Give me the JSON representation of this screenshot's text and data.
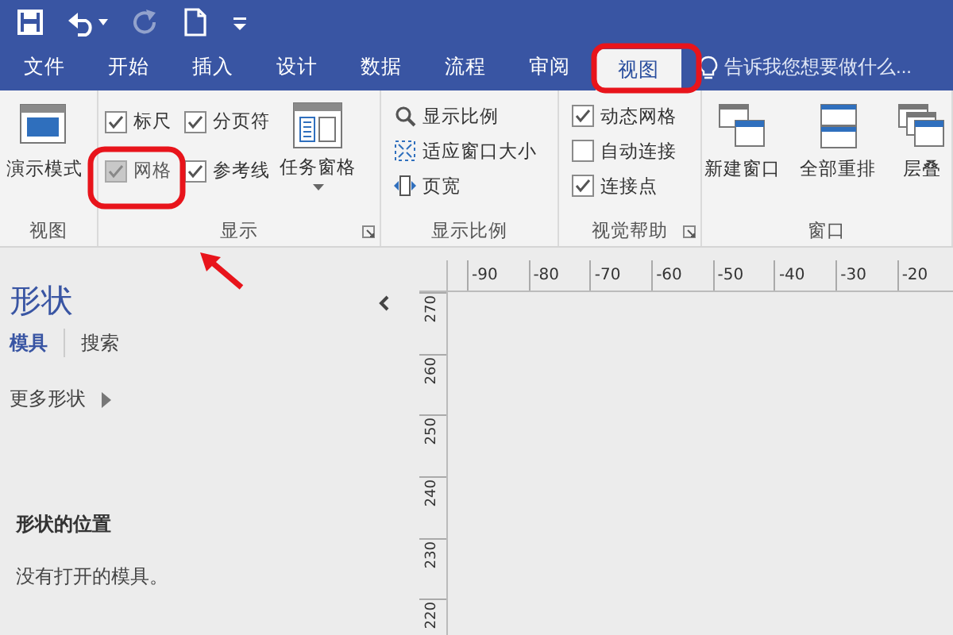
{
  "quick_access": [
    {
      "kind": "save",
      "disabled": false
    },
    {
      "kind": "undo",
      "disabled": false
    },
    {
      "kind": "redo",
      "disabled": true
    },
    {
      "kind": "new",
      "disabled": false
    },
    {
      "kind": "customize",
      "disabled": false
    }
  ],
  "tabs": [
    {
      "label": "文件",
      "selected": false
    },
    {
      "label": "开始",
      "selected": false
    },
    {
      "label": "插入",
      "selected": false
    },
    {
      "label": "设计",
      "selected": false
    },
    {
      "label": "数据",
      "selected": false
    },
    {
      "label": "流程",
      "selected": false
    },
    {
      "label": "审阅",
      "selected": false
    },
    {
      "label": "视图",
      "selected": true
    }
  ],
  "tell_me": {
    "placeholder": "告诉我您想要做什么..."
  },
  "ribbon_groups": [
    {
      "label": "视图",
      "launcher": false,
      "items": [
        {
          "kind": "large",
          "label": "演示模式"
        }
      ]
    },
    {
      "label": "显示",
      "launcher": true,
      "items": [
        {
          "kind": "check",
          "label": "标尺",
          "checked": true,
          "disabled": false
        },
        {
          "kind": "check",
          "label": "分页符",
          "checked": true,
          "disabled": false
        },
        {
          "kind": "check",
          "label": "网格",
          "checked": true,
          "disabled": true
        },
        {
          "kind": "check",
          "label": "参考线",
          "checked": true,
          "disabled": false
        },
        {
          "kind": "large",
          "label": "任务窗格",
          "dropdown": true
        }
      ]
    },
    {
      "label": "显示比例",
      "launcher": false,
      "items": [
        {
          "kind": "small",
          "label": "显示比例"
        },
        {
          "kind": "small",
          "label": "适应窗口大小"
        },
        {
          "kind": "small",
          "label": "页宽"
        }
      ]
    },
    {
      "label": "视觉帮助",
      "launcher": true,
      "items": [
        {
          "kind": "check",
          "label": "动态网格",
          "checked": true,
          "disabled": false
        },
        {
          "kind": "check",
          "label": "自动连接",
          "checked": false,
          "disabled": false
        },
        {
          "kind": "check",
          "label": "连接点",
          "checked": true,
          "disabled": false
        }
      ]
    },
    {
      "label": "窗口",
      "launcher": false,
      "items": [
        {
          "kind": "large",
          "label": "新建窗口"
        },
        {
          "kind": "large",
          "label": "全部重排"
        },
        {
          "kind": "large",
          "label": "层叠"
        }
      ]
    }
  ],
  "shapes_panel": {
    "title": "形状",
    "tabs": [
      {
        "label": "模具",
        "selected": true
      },
      {
        "label": "搜索",
        "selected": false
      }
    ],
    "more_shapes": "更多形状",
    "section_title": "形状的位置",
    "message": "没有打开的模具。"
  },
  "ruler": {
    "horizontal": [
      "-90",
      "-80",
      "-70",
      "-60",
      "-50",
      "-40",
      "-30",
      "-20"
    ],
    "vertical": [
      "270",
      "260",
      "250",
      "240",
      "230",
      "220"
    ]
  }
}
